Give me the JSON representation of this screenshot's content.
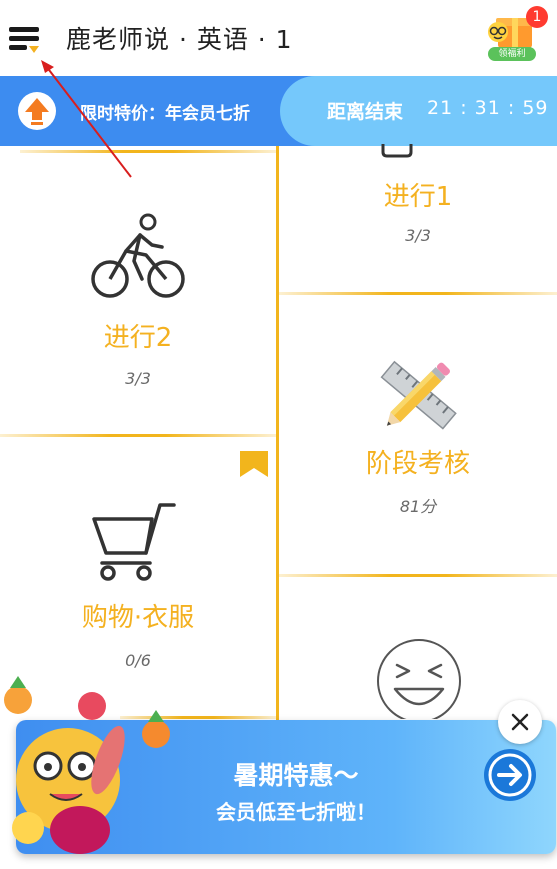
{
  "header": {
    "title": "鹿老师说 · 英语 · 1",
    "menu_icon": "menu-icon",
    "gift": {
      "icon": "gift-box-icon",
      "badge": "1",
      "label": "领福利"
    }
  },
  "promo": {
    "left_text": "限时特价：年会员七折",
    "countdown_label": "距离结束",
    "countdown": "21 : 31 : 59",
    "icon": "up-arrow-icon",
    "colors": {
      "left": "#3d8cf0",
      "right": "#75c8fb"
    }
  },
  "lessons": {
    "top_right": {
      "title": "进行1",
      "progress": "3/3",
      "icon": "partial-icon"
    },
    "cycling": {
      "title": "进行2",
      "progress": "3/3",
      "icon": "bicycle-icon"
    },
    "exam": {
      "title": "阶段考核",
      "progress": "81分",
      "icon": "ruler-pencil-icon"
    },
    "shopping": {
      "title": "购物·衣服",
      "progress": "0/6",
      "icon": "shopping-cart-icon",
      "bookmark_icon": "bookmark-icon"
    },
    "bottom_right": {
      "icon": "laughing-face-icon"
    },
    "accent_color": "#f2b51c"
  },
  "popup": {
    "title": "暑期特惠～",
    "subtitle": "会员低至七折啦！",
    "go_icon": "arrow-right-icon",
    "close_icon": "close-icon",
    "mascot_icon": "fruit-mascot-icon"
  }
}
